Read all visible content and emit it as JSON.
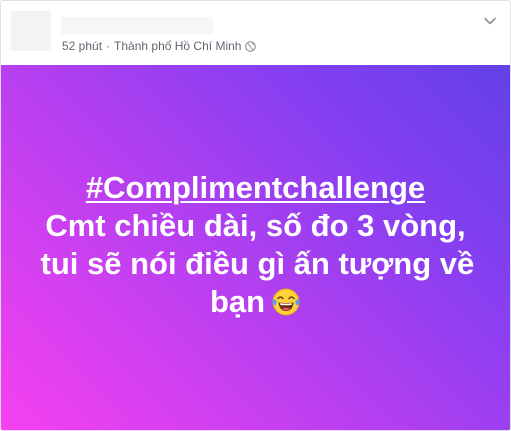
{
  "header": {
    "time": "52 phút",
    "separator": "·",
    "location": "Thành phố Hồ Chí Minh",
    "privacy_icon": "globe-icon",
    "options_icon": "chevron-down-icon"
  },
  "card": {
    "hashtag": "#Complimentchallenge",
    "lines": [
      "Cmt chiều dài, số đo 3 vòng,",
      "tui sẽ nói điều gì ấn tượng về",
      "bạn"
    ],
    "emoji_icon": "laughing-tears-emoji-icon",
    "colors": {
      "gradient_start": "#f641f0",
      "gradient_mid": "#8a3ff1",
      "gradient_end": "#6340e6",
      "text": "#ffffff"
    }
  }
}
